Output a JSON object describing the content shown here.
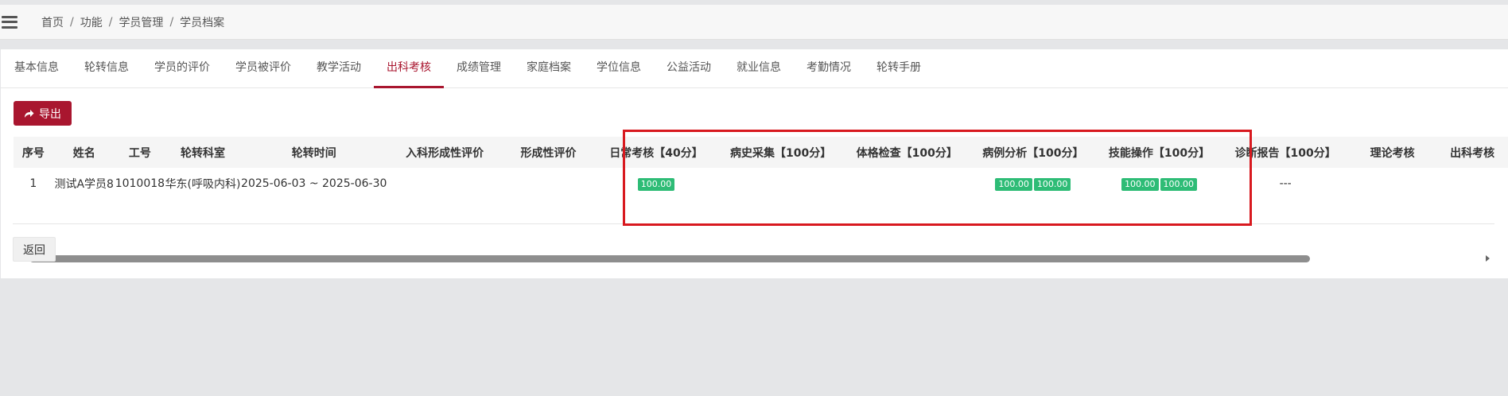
{
  "breadcrumb": [
    "首页",
    "功能",
    "学员管理",
    "学员档案"
  ],
  "tabs": [
    "基本信息",
    "轮转信息",
    "学员的评价",
    "学员被评价",
    "教学活动",
    "出科考核",
    "成绩管理",
    "家庭档案",
    "学位信息",
    "公益活动",
    "就业信息",
    "考勤情况",
    "轮转手册"
  ],
  "active_tab": "出科考核",
  "toolbar": {
    "export_label": "导出",
    "export_icon": "share-arrow-icon"
  },
  "table": {
    "headers": [
      "序号",
      "姓名",
      "工号",
      "轮转科室",
      "轮转时间",
      "入科形成性评价",
      "形成性评价",
      "日常考核【40分】",
      "病史采集【100分】",
      "体格检查【100分】",
      "病例分析【100分】",
      "技能操作【100分】",
      "诊断报告【100分】",
      "理论考核",
      "出科考核"
    ],
    "row": {
      "index": "1",
      "name": "测试A学员8",
      "employee_no": "1010018",
      "department": "华东(呼吸内科)",
      "period": "2025-06-03 ~ 2025-06-30",
      "entry_eval": "",
      "formative_eval": "",
      "daily_scores": [
        "100.00"
      ],
      "history_scores": [],
      "physical_scores": [],
      "case_scores": [
        "100.00",
        "100.00"
      ],
      "skill_scores": [
        "100.00",
        "100.00"
      ],
      "diagnosis": "---",
      "theory": "",
      "final": ""
    }
  },
  "footer": {
    "back_label": "返回"
  },
  "colors": {
    "accent": "#a9162f",
    "score_badge": "#2ebc76",
    "highlight_box": "#d8191f"
  }
}
